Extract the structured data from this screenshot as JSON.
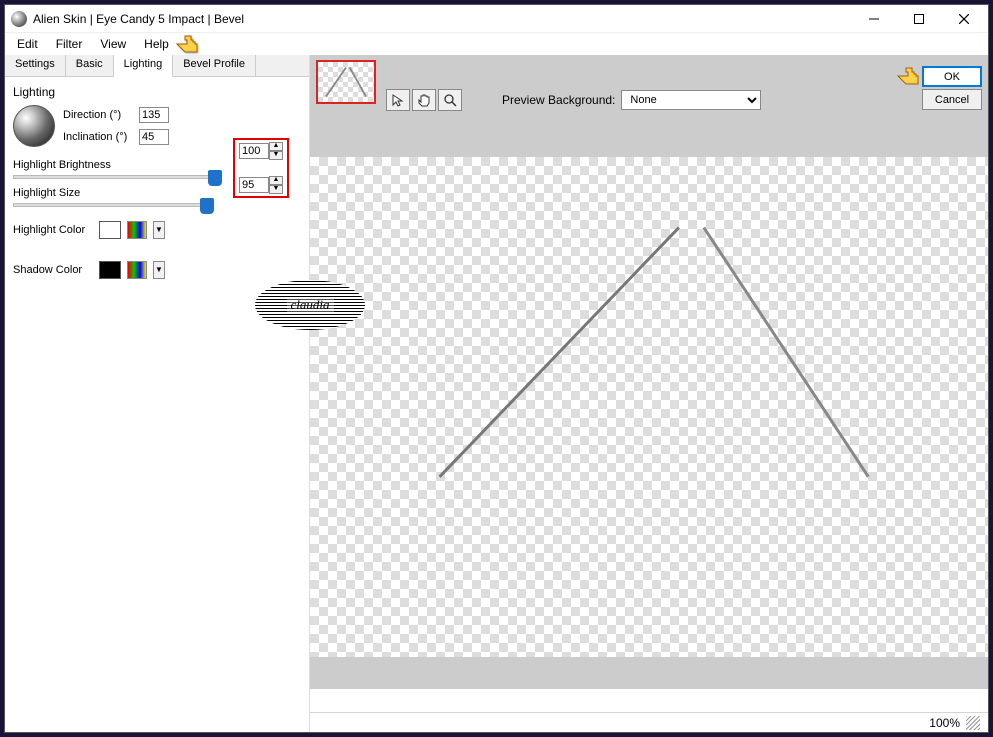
{
  "window": {
    "title": "Alien Skin | Eye Candy 5 Impact | Bevel"
  },
  "menu": {
    "edit": "Edit",
    "filter": "Filter",
    "view": "View",
    "help": "Help"
  },
  "tabs": {
    "settings": "Settings",
    "basic": "Basic",
    "lighting": "Lighting",
    "bevel_profile": "Bevel Profile"
  },
  "panel": {
    "section": "Lighting",
    "direction_label": "Direction (°)",
    "direction_value": "135",
    "inclination_label": "Inclination (°)",
    "inclination_value": "45",
    "highlight_brightness_label": "Highlight Brightness",
    "highlight_brightness_value": "100",
    "highlight_size_label": "Highlight Size",
    "highlight_size_value": "95",
    "highlight_color_label": "Highlight Color",
    "shadow_color_label": "Shadow Color"
  },
  "preview": {
    "bg_label": "Preview Background:",
    "bg_value": "None"
  },
  "buttons": {
    "ok": "OK",
    "cancel": "Cancel"
  },
  "status": {
    "zoom": "100%"
  },
  "stamp": {
    "text": "claudia"
  },
  "colors": {
    "highlight_swatch": "#ffffff",
    "shadow_swatch": "#000000"
  }
}
